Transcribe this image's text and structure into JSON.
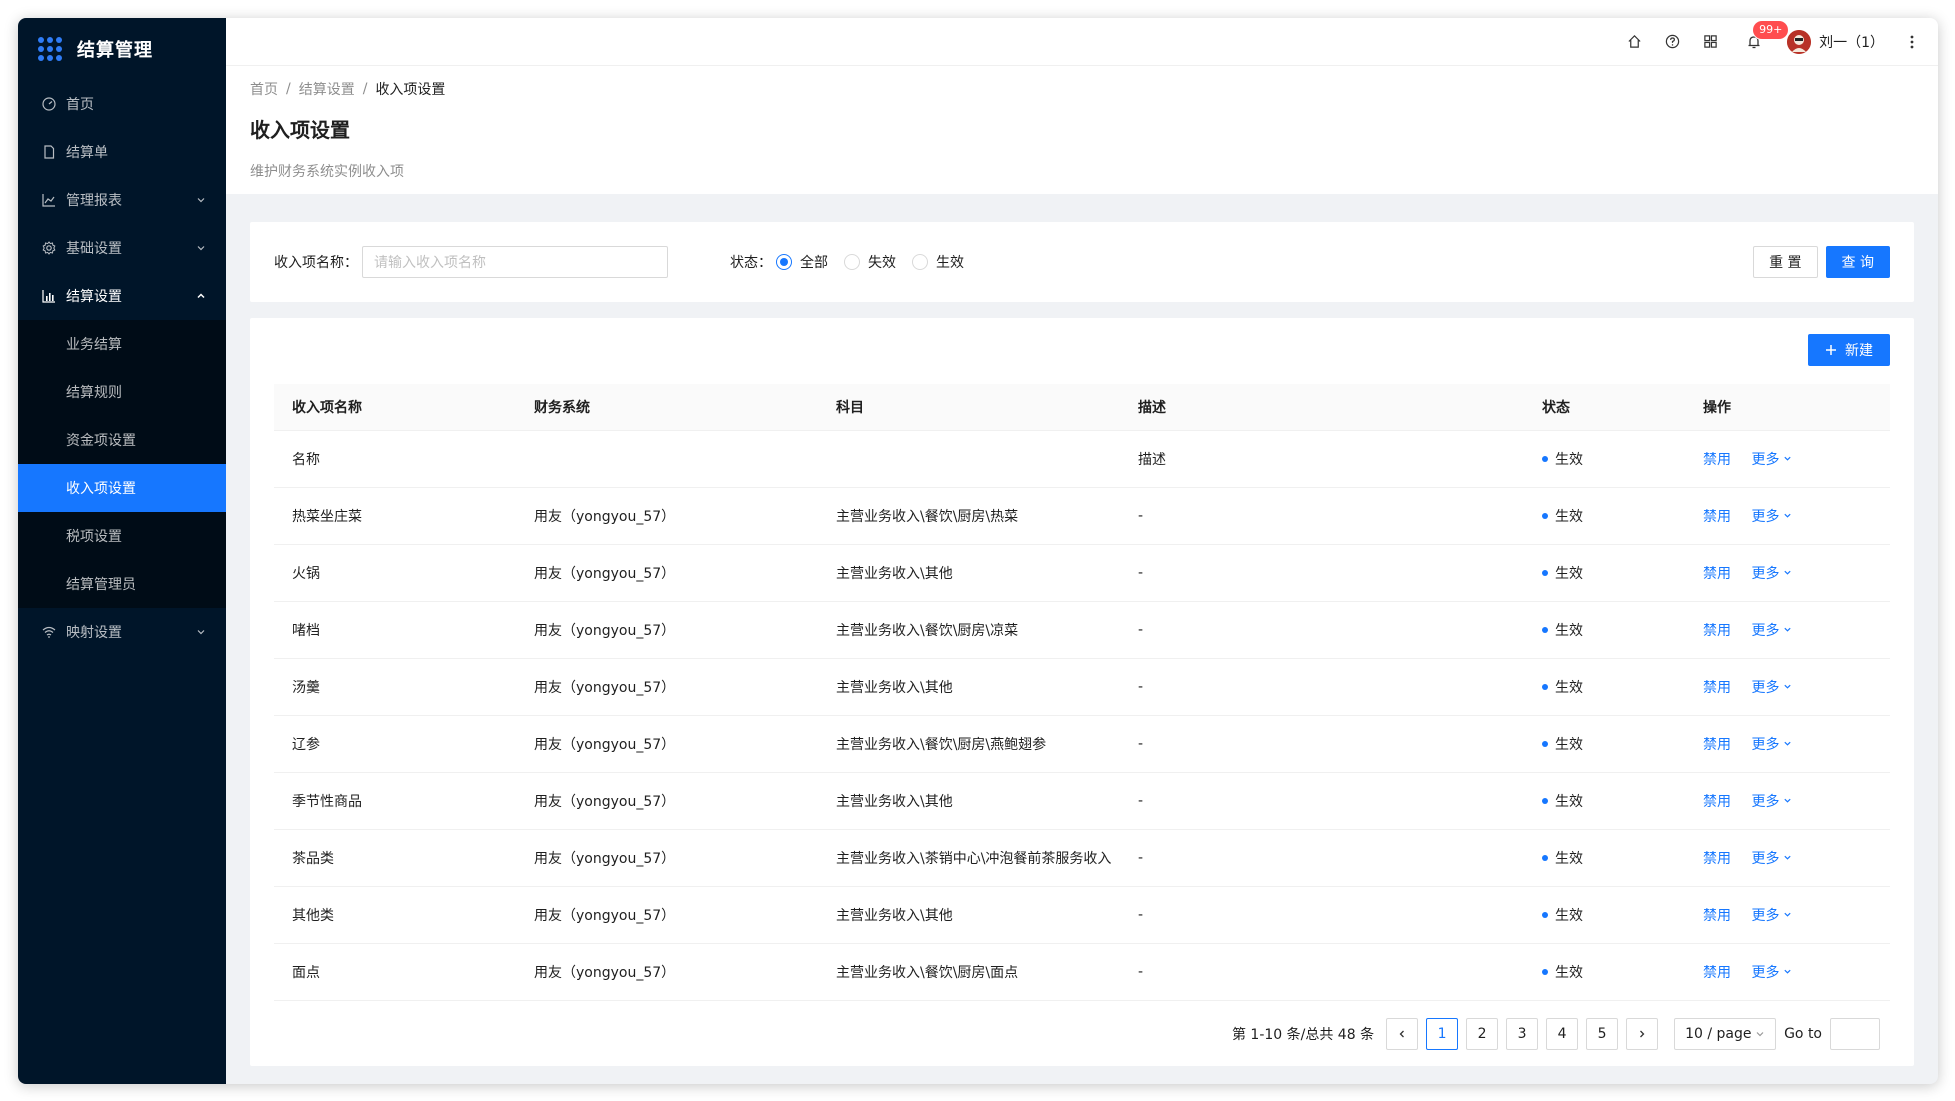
{
  "sidebar": {
    "app_title": "结算管理",
    "items": [
      {
        "label": "首页",
        "icon": "dashboard-icon"
      },
      {
        "label": "结算单",
        "icon": "file-icon"
      },
      {
        "label": "管理报表",
        "icon": "line-chart-icon"
      },
      {
        "label": "基础设置",
        "icon": "setting-icon"
      },
      {
        "label": "结算设置",
        "icon": "bar-chart-icon"
      },
      {
        "label": "映射设置",
        "icon": "wifi-icon"
      }
    ],
    "sub_items": [
      "业务结算",
      "结算规则",
      "资金项设置",
      "收入项设置",
      "税项设置",
      "结算管理员"
    ],
    "active_sub": "收入项设置"
  },
  "header": {
    "notification_badge": "99+",
    "user_name": "刘一（1）"
  },
  "page": {
    "breadcrumb": [
      "首页",
      "结算设置",
      "收入项设置"
    ],
    "title": "收入项设置",
    "description": "维护财务系统实例收入项"
  },
  "search": {
    "name_label": "收入项名称：",
    "name_placeholder": "请输入收入项名称",
    "status_label": "状态：",
    "status_options": [
      "全部",
      "失效",
      "生效"
    ],
    "status_selected": "全部",
    "reset_label": "重 置",
    "query_label": "查 询"
  },
  "table": {
    "new_label": "新建",
    "columns": [
      "收入项名称",
      "财务系统",
      "科目",
      "描述",
      "状态",
      "操作"
    ],
    "action_disable": "禁用",
    "action_more": "更多",
    "rows": [
      {
        "name": "名称",
        "system": "",
        "subject": "",
        "desc": "描述",
        "status": "生效"
      },
      {
        "name": "热菜坐庄菜",
        "system": "用友（yongyou_57）",
        "subject": "主营业务收入\\餐饮\\厨房\\热菜",
        "desc": "-",
        "status": "生效"
      },
      {
        "name": "火锅",
        "system": "用友（yongyou_57）",
        "subject": "主营业务收入\\其他",
        "desc": "-",
        "status": "生效"
      },
      {
        "name": "啫档",
        "system": "用友（yongyou_57）",
        "subject": "主营业务收入\\餐饮\\厨房\\凉菜",
        "desc": "-",
        "status": "生效"
      },
      {
        "name": "汤羹",
        "system": "用友（yongyou_57）",
        "subject": "主营业务收入\\其他",
        "desc": "-",
        "status": "生效"
      },
      {
        "name": "辽参",
        "system": "用友（yongyou_57）",
        "subject": "主营业务收入\\餐饮\\厨房\\燕鲍翅参",
        "desc": "-",
        "status": "生效"
      },
      {
        "name": "季节性商品",
        "system": "用友（yongyou_57）",
        "subject": "主营业务收入\\其他",
        "desc": "-",
        "status": "生效"
      },
      {
        "name": "茶品类",
        "system": "用友（yongyou_57）",
        "subject": "主营业务收入\\茶销中心\\冲泡餐前茶服务收入",
        "desc": "-",
        "status": "生效"
      },
      {
        "name": "其他类",
        "system": "用友（yongyou_57）",
        "subject": "主营业务收入\\其他",
        "desc": "-",
        "status": "生效"
      },
      {
        "name": "面点",
        "system": "用友（yongyou_57）",
        "subject": "主营业务收入\\餐饮\\厨房\\面点",
        "desc": "-",
        "status": "生效"
      }
    ]
  },
  "pagination": {
    "total_text": "第 1-10 条/总共 48 条",
    "pages": [
      "1",
      "2",
      "3",
      "4",
      "5"
    ],
    "current": "1",
    "page_size": "10 / page",
    "goto_label": "Go to"
  },
  "colors": {
    "primary": "#1677ff",
    "sidebar_bg": "#001529",
    "badge": "#ff4d4f"
  }
}
